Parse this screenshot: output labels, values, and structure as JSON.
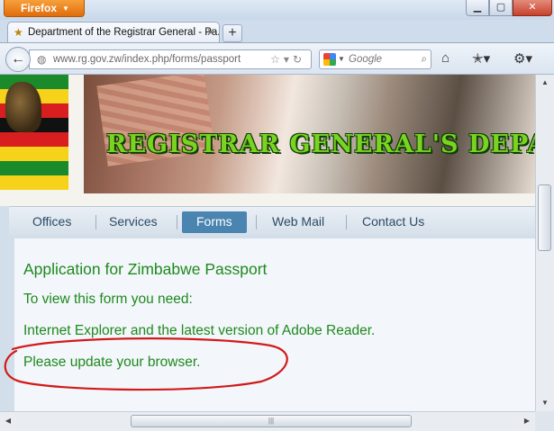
{
  "browser": {
    "app_button": "Firefox",
    "tab_title": "Department of the Registrar General - Pa...",
    "new_tab": "+",
    "url": "www.rg.gov.zw/index.php/forms/passport",
    "search_placeholder": "Google",
    "window_controls": {
      "minimize": "▁",
      "maximize": "▢",
      "close": "✕"
    }
  },
  "banner": {
    "title": "REGISTRAR GENERAL'S DEPA"
  },
  "menu": {
    "items": [
      {
        "label": "Offices"
      },
      {
        "label": "Services"
      },
      {
        "label": "Forms",
        "active": true
      },
      {
        "label": "Web Mail"
      },
      {
        "label": "Contact Us"
      }
    ]
  },
  "page": {
    "heading": "Application for Zimbabwe Passport",
    "lines": [
      "To view this form you need:",
      "Internet Explorer and the latest version of Adobe Reader.",
      "Please update your browser."
    ]
  },
  "colors": {
    "body_text": "#1e8a1e",
    "annotation": "#d11a1a",
    "menu_active": "#4a84b0",
    "firefox_orange": "#e87d1e"
  },
  "icons": [
    "back-icon",
    "globe-icon",
    "bookmark-star-icon",
    "reload-icon",
    "google-icon",
    "search-icon",
    "home-icon",
    "bookmarks-icon",
    "addon-icon"
  ]
}
